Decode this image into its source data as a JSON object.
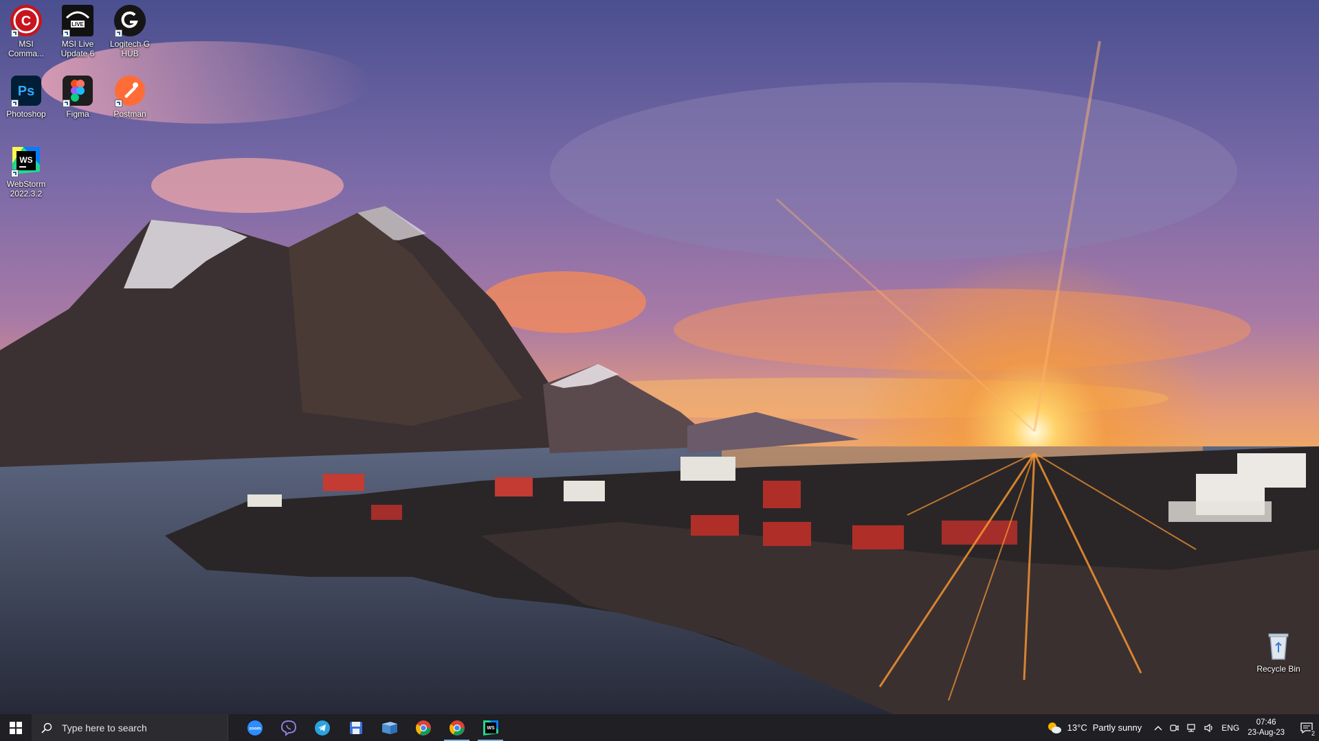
{
  "desktop_icons": [
    {
      "id": "msi-center",
      "label": "MSI Comma...",
      "icon": "msi-center-icon"
    },
    {
      "id": "msi-live-update",
      "label": "MSI Live Update 6",
      "icon": "msi-live-update-icon"
    },
    {
      "id": "logitech-g-hub",
      "label": "Logitech G HUB",
      "icon": "logitech-g-icon"
    },
    {
      "id": "photoshop",
      "label": "Photoshop",
      "icon": "photoshop-icon",
      "glyph": "Ps"
    },
    {
      "id": "figma",
      "label": "Figma",
      "icon": "figma-icon"
    },
    {
      "id": "postman",
      "label": "Postman",
      "icon": "postman-icon"
    },
    {
      "id": "webstorm",
      "label": "WebStorm 2022.3.2",
      "icon": "webstorm-icon",
      "glyph": "WS"
    },
    {
      "id": "recycle-bin",
      "label": "Recycle Bin",
      "icon": "recycle-bin-icon"
    }
  ],
  "taskbar": {
    "search_placeholder": "Type here to search",
    "pinned": [
      {
        "name": "zoom",
        "icon": "zoom-icon",
        "glyph": "zoom"
      },
      {
        "name": "viber",
        "icon": "viber-icon"
      },
      {
        "name": "telegram",
        "icon": "telegram-icon"
      },
      {
        "name": "save-app",
        "icon": "floppy-disk-icon"
      },
      {
        "name": "file-explorer",
        "icon": "file-explorer-icon"
      },
      {
        "name": "chrome",
        "icon": "chrome-icon"
      },
      {
        "name": "chrome-profile-2",
        "icon": "chrome-icon"
      },
      {
        "name": "webstorm",
        "icon": "webstorm-icon",
        "glyph": "WS"
      }
    ]
  },
  "tray": {
    "weather_temp": "13°C",
    "weather_text": "Partly sunny",
    "language": "ENG",
    "time": "07:46",
    "date": "23-Aug-23",
    "notification_count": "2"
  },
  "colors": {
    "taskbar_bg": "#1f1f24",
    "search_bg": "#2b2b30",
    "active_indicator": "#7fb3e6"
  }
}
